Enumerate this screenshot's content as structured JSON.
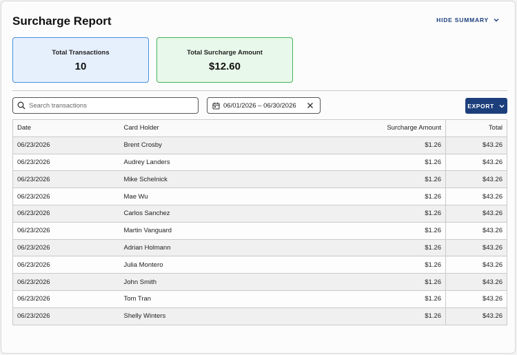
{
  "header": {
    "title": "Surcharge Report",
    "hide_summary_label": "HIDE SUMMARY"
  },
  "summary": {
    "total_transactions_label": "Total Transactions",
    "total_transactions_value": "10",
    "total_surcharge_label": "Total Surcharge Amount",
    "total_surcharge_value": "$12.60"
  },
  "filters": {
    "search_placeholder": "Search transactions",
    "date_range": "06/01/2026 – 06/30/2026"
  },
  "toolbar": {
    "export_label": "EXPORT"
  },
  "table": {
    "columns": [
      "Date",
      "Card Holder",
      "Surcharge Amount",
      "Total"
    ],
    "rows": [
      {
        "date": "06/23/2026",
        "holder": "Brent Crosby",
        "surcharge": "$1.26",
        "total": "$43.26"
      },
      {
        "date": "06/23/2026",
        "holder": "Audrey Landers",
        "surcharge": "$1.26",
        "total": "$43.26"
      },
      {
        "date": "06/23/2026",
        "holder": "Mike Schelnick",
        "surcharge": "$1.26",
        "total": "$43.26"
      },
      {
        "date": "06/23/2026",
        "holder": "Mae Wu",
        "surcharge": "$1.26",
        "total": "$43.26"
      },
      {
        "date": "06/23/2026",
        "holder": "Carlos Sanchez",
        "surcharge": "$1.26",
        "total": "$43.26"
      },
      {
        "date": "06/23/2026",
        "holder": "Martin Vanguard",
        "surcharge": "$1.26",
        "total": "$43.26"
      },
      {
        "date": "06/23/2026",
        "holder": "Adrian Holmann",
        "surcharge": "$1.26",
        "total": "$43.26"
      },
      {
        "date": "06/23/2026",
        "holder": "Julia Montero",
        "surcharge": "$1.26",
        "total": "$43.26"
      },
      {
        "date": "06/23/2026",
        "holder": "John Smith",
        "surcharge": "$1.26",
        "total": "$43.26"
      },
      {
        "date": "06/23/2026",
        "holder": "Tom Tran",
        "surcharge": "$1.26",
        "total": "$43.26"
      },
      {
        "date": "06/23/2026",
        "holder": "Shelly Winters",
        "surcharge": "$1.26",
        "total": "$43.26"
      }
    ]
  },
  "colors": {
    "accent": "#1c3f7c",
    "card_blue_bg": "#e6f0fd",
    "card_green_bg": "#e8f8ea"
  },
  "icons": {
    "search": "search-icon",
    "calendar": "calendar-icon",
    "clear": "close-icon",
    "chevron": "chevron-down-icon"
  }
}
